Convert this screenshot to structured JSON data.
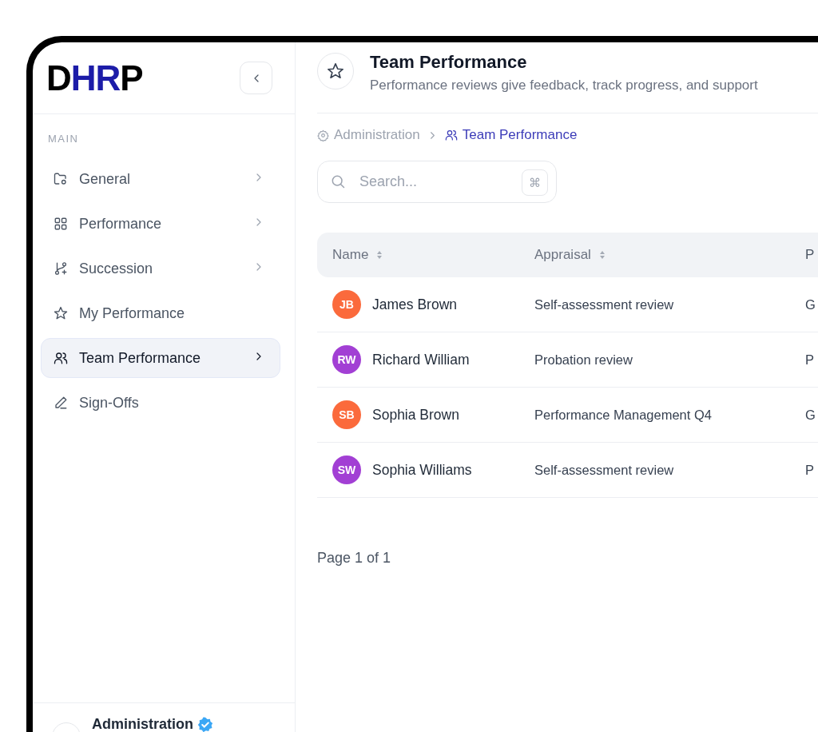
{
  "sidebar": {
    "logo": [
      {
        "text": "D",
        "accent": false
      },
      {
        "text": "HR",
        "accent": true
      },
      {
        "text": "P",
        "accent": false
      }
    ],
    "section_label": "MAIN",
    "items": [
      {
        "label": "General",
        "submenu": true,
        "selected": false
      },
      {
        "label": "Performance",
        "submenu": true,
        "selected": false
      },
      {
        "label": "Succession",
        "submenu": true,
        "selected": false
      },
      {
        "label": "My Performance",
        "submenu": false,
        "selected": false
      },
      {
        "label": "Team Performance",
        "submenu": true,
        "selected": true
      },
      {
        "label": "Sign-Offs",
        "submenu": false,
        "selected": false
      }
    ],
    "user": {
      "name": "Administration",
      "verified": true
    }
  },
  "header": {
    "title": "Team Performance",
    "subtitle": "Performance reviews give feedback, track progress, and support"
  },
  "breadcrumb": [
    {
      "label": "Administration",
      "current": false
    },
    {
      "label": "Team Performance",
      "current": true
    }
  ],
  "search": {
    "placeholder": "Search...",
    "shortcut": "⌘"
  },
  "table": {
    "columns": [
      {
        "label": "Name",
        "sortable": true
      },
      {
        "label": "Appraisal",
        "sortable": true
      },
      {
        "label": "P",
        "sortable": false
      }
    ],
    "rows": [
      {
        "initials": "JB",
        "color": "#fb6a3c",
        "name": "James Brown",
        "appraisal": "Self-assessment review",
        "column_3": "G"
      },
      {
        "initials": "RW",
        "color": "#a23fd4",
        "name": "Richard William",
        "appraisal": "Probation review",
        "column_3": "P"
      },
      {
        "initials": "SB",
        "color": "#fb6a3c",
        "name": "Sophia Brown",
        "appraisal": "Performance Management Q4",
        "column_3": "G"
      },
      {
        "initials": "SW",
        "color": "#a23fd4",
        "name": "Sophia Williams",
        "appraisal": "Self-assessment review",
        "column_3": "P"
      }
    ]
  },
  "pagination": "Page 1 of 1"
}
